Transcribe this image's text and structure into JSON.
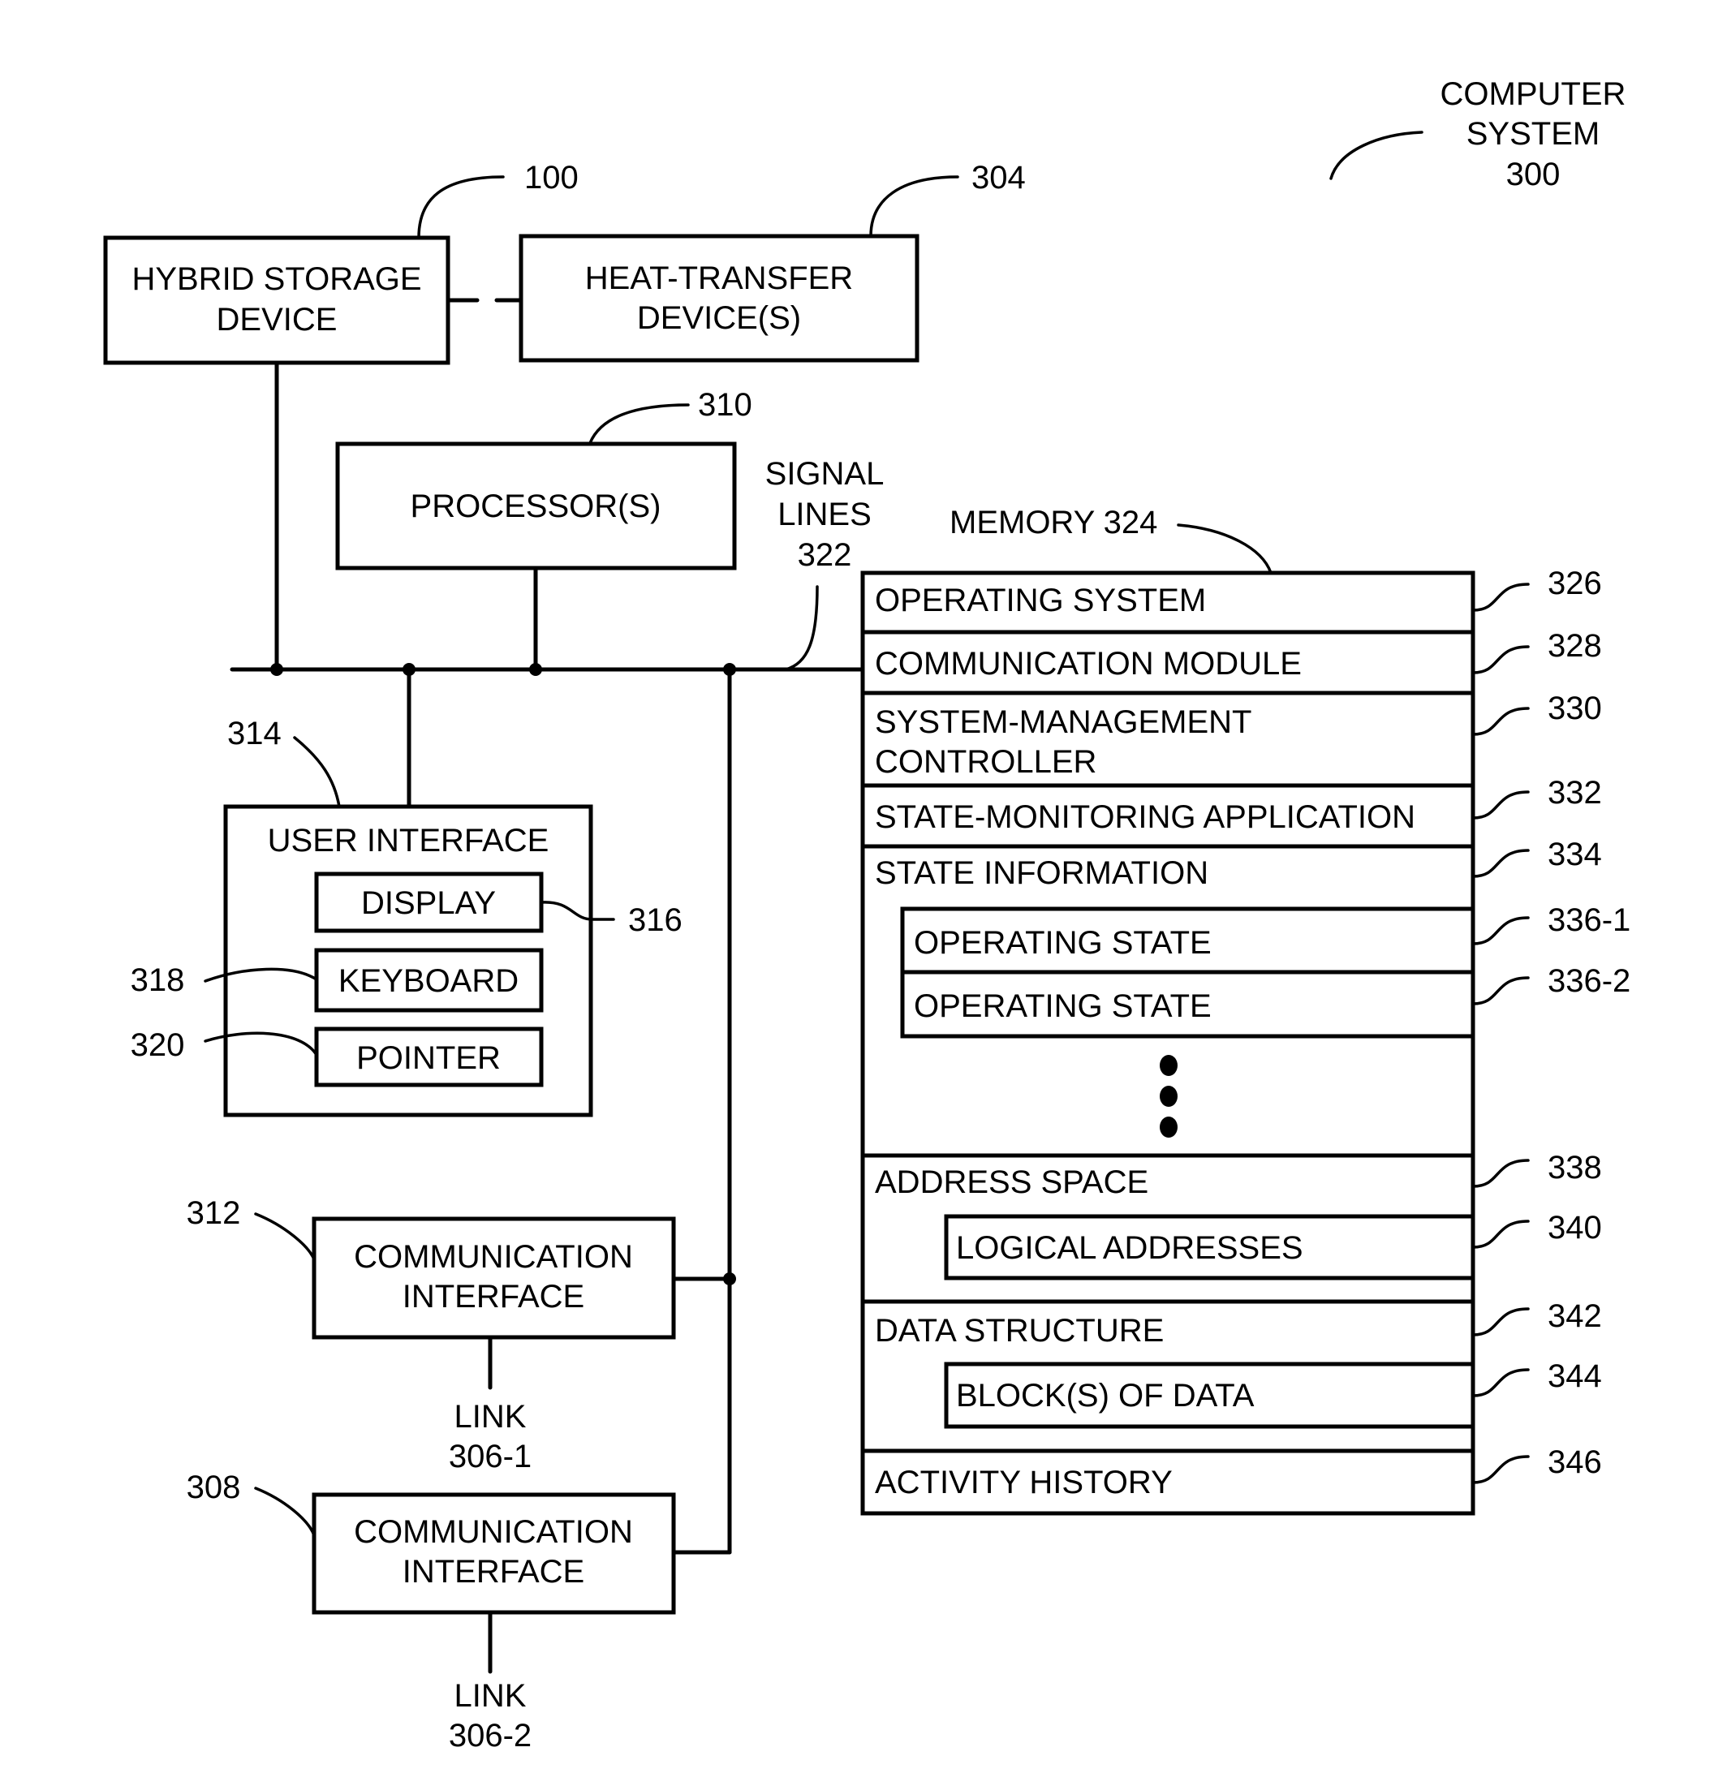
{
  "figure": {
    "title_lines": [
      "COMPUTER",
      "SYSTEM",
      "300"
    ]
  },
  "blocks": {
    "hybrid_storage": {
      "lines": [
        "HYBRID STORAGE",
        "DEVICE"
      ],
      "ref": "100"
    },
    "heat_transfer": {
      "lines": [
        "HEAT-TRANSFER",
        "DEVICE(S)"
      ],
      "ref": "304"
    },
    "processor": {
      "label": "PROCESSOR(S)",
      "ref": "310"
    },
    "signal_lines": {
      "lines": [
        "SIGNAL",
        "LINES",
        "322"
      ]
    },
    "user_interface": {
      "label": "USER INTERFACE",
      "ref": "314",
      "display": {
        "label": "DISPLAY",
        "ref": "316"
      },
      "keyboard": {
        "label": "KEYBOARD",
        "ref": "318"
      },
      "pointer": {
        "label": "POINTER",
        "ref": "320"
      }
    },
    "comm_interface_1": {
      "lines": [
        "COMMUNICATION",
        "INTERFACE"
      ],
      "ref": "312",
      "link_lines": [
        "LINK",
        "306-1"
      ]
    },
    "comm_interface_2": {
      "lines": [
        "COMMUNICATION",
        "INTERFACE"
      ],
      "ref": "308",
      "link_lines": [
        "LINK",
        "306-2"
      ]
    }
  },
  "memory": {
    "label": "MEMORY 324",
    "rows": [
      {
        "label": "OPERATING SYSTEM",
        "ref": "326"
      },
      {
        "label": "COMMUNICATION MODULE",
        "ref": "328"
      },
      {
        "lines": [
          "SYSTEM-MANAGEMENT",
          "CONTROLLER"
        ],
        "ref": "330"
      },
      {
        "label": "STATE-MONITORING APPLICATION",
        "ref": "332"
      },
      {
        "label": "STATE INFORMATION",
        "ref": "334",
        "children": [
          {
            "label": "OPERATING STATE",
            "ref": "336-1"
          },
          {
            "label": "OPERATING STATE",
            "ref": "336-2"
          }
        ],
        "ellipsis": "more operating states"
      },
      {
        "label": "ADDRESS SPACE",
        "ref": "338",
        "children": [
          {
            "label": "LOGICAL ADDRESSES",
            "ref": "340"
          }
        ]
      },
      {
        "label": "DATA STRUCTURE",
        "ref": "342",
        "children": [
          {
            "label": "BLOCK(S) OF DATA",
            "ref": "344"
          }
        ]
      },
      {
        "label": "ACTIVITY HISTORY",
        "ref": "346"
      }
    ]
  }
}
